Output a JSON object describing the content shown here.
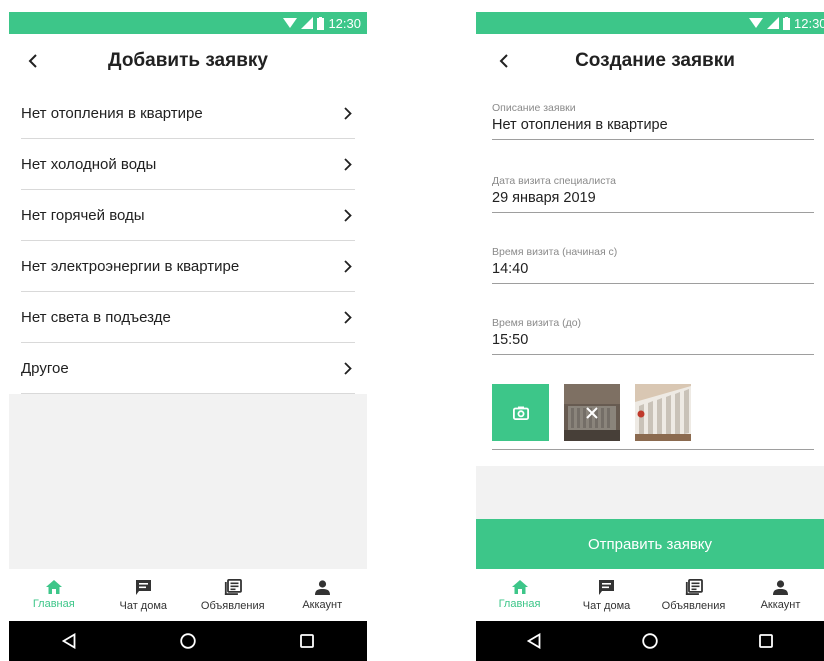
{
  "status_bar": {
    "time": "12:30"
  },
  "left_screen": {
    "title": "Добавить заявку",
    "items": [
      {
        "label": "Нет отопления в квартире"
      },
      {
        "label": "Нет холодной воды"
      },
      {
        "label": "Нет горячей воды"
      },
      {
        "label": "Нет электроэнергии в квартире"
      },
      {
        "label": "Нет света в подъезде"
      },
      {
        "label": "Другое"
      }
    ]
  },
  "right_screen": {
    "title": "Создание заявки",
    "fields": [
      {
        "label": "Описание заявки",
        "value": "Нет отопления в квартире"
      },
      {
        "label": "Дата визита специалиста",
        "value": "29 января 2019"
      },
      {
        "label": "Время визита (начиная с)",
        "value": "14:40"
      },
      {
        "label": "Время визита (до)",
        "value": "15:50"
      }
    ],
    "submit_label": "Отправить заявку"
  },
  "bottom_nav": {
    "items": [
      {
        "label": "Главная",
        "icon": "home-icon",
        "active": true
      },
      {
        "label": "Чат дома",
        "icon": "chat-icon",
        "active": false
      },
      {
        "label": "Объявления",
        "icon": "news-icon",
        "active": false
      },
      {
        "label": "Аккаунт",
        "icon": "account-icon",
        "active": false
      }
    ]
  },
  "colors": {
    "accent": "#3dc689",
    "background": "#f2f2f2",
    "text": "#212121",
    "label": "#8a8a8a"
  }
}
